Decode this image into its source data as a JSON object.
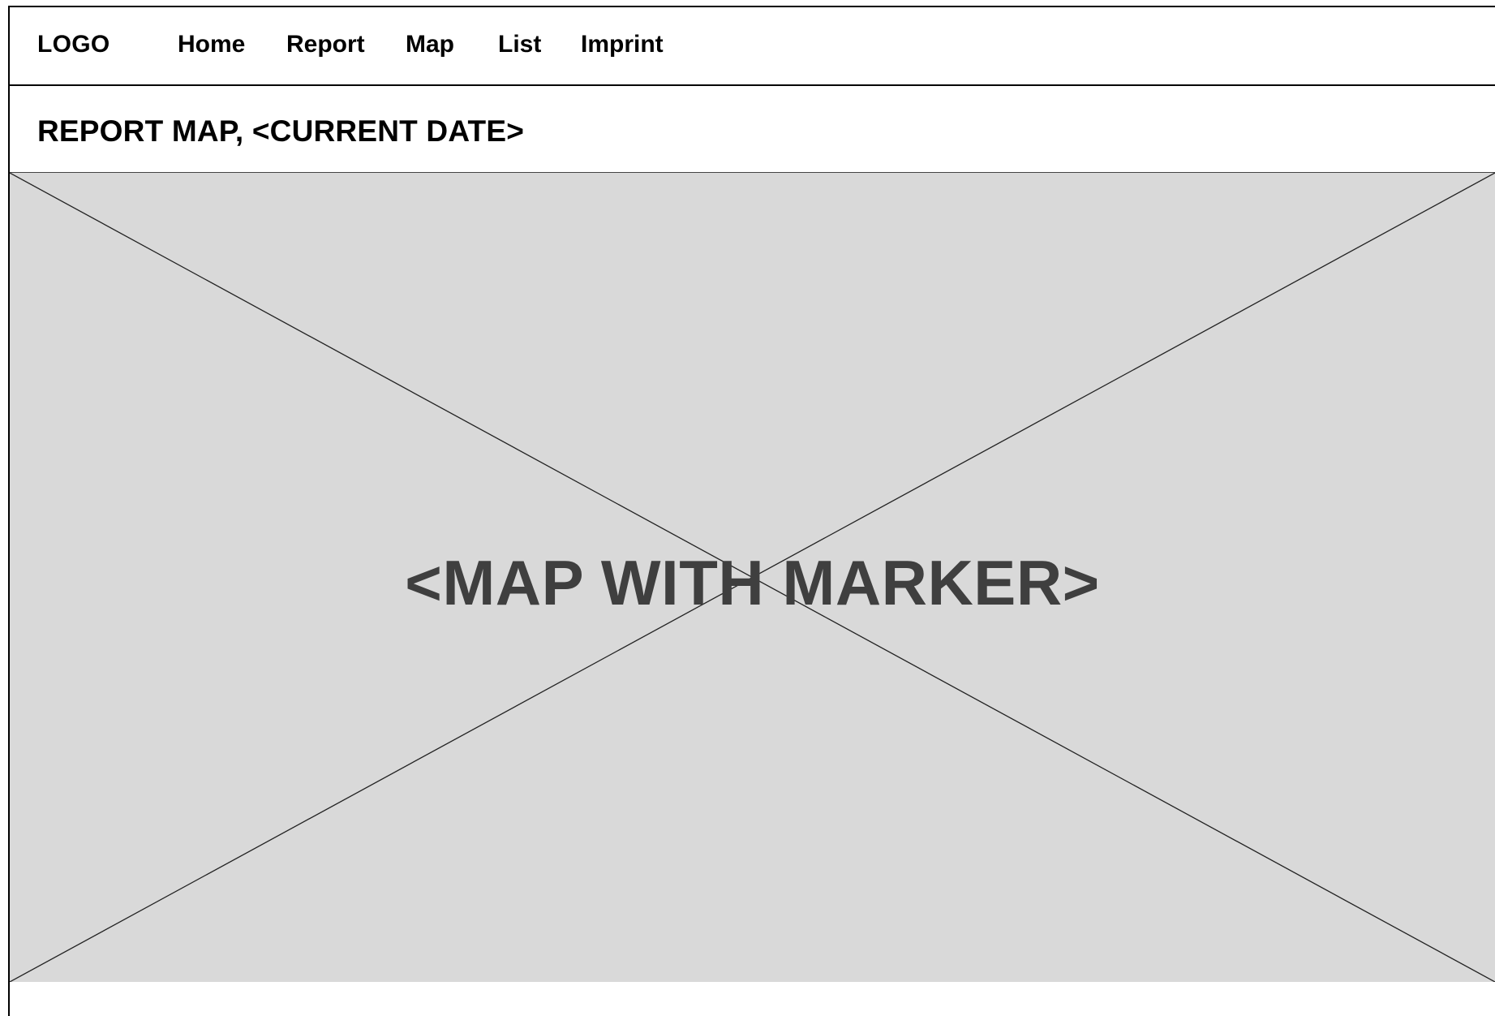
{
  "header": {
    "logo": "LOGO",
    "nav": {
      "home": "Home",
      "report": "Report",
      "map": "Map",
      "list": "List",
      "imprint": "Imprint"
    }
  },
  "page": {
    "title": "REPORT MAP, <CURRENT DATE>"
  },
  "map": {
    "placeholder_label": "<MAP WITH MARKER>",
    "background_color": "#d9d9d9",
    "label_color": "#3f3f3f"
  }
}
